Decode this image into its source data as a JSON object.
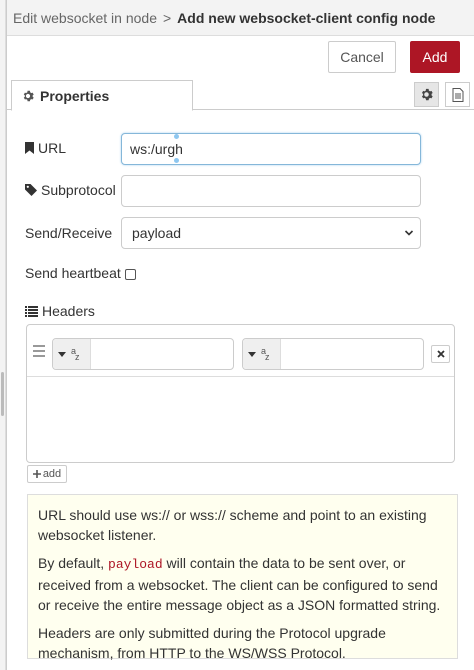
{
  "breadcrumb": {
    "previous": "Edit websocket in node",
    "separator": ">",
    "current": "Add new websocket-client config node"
  },
  "toolbar": {
    "cancel_label": "Cancel",
    "add_label": "Add"
  },
  "tabs": {
    "properties_label": "Properties",
    "icons": [
      "gear-icon",
      "description-icon"
    ]
  },
  "form": {
    "url": {
      "label": "URL",
      "value": "ws:/urgh"
    },
    "subprotocol": {
      "label": "Subprotocol",
      "value": ""
    },
    "send_receive": {
      "label": "Send/Receive",
      "selected": "payload"
    },
    "heartbeat": {
      "label": "Send heartbeat",
      "checked": false
    },
    "headers": {
      "label": "Headers"
    }
  },
  "headers_add_label": "add",
  "help": {
    "p1": "URL should use ws:// or wss:// scheme and point to an existing websocket listener.",
    "p2_before": "By default, ",
    "p2_code": "payload",
    "p2_after": " will contain the data to be sent over, or received from a websocket. The client can be configured to send or receive the entire message object as a JSON formatted string.",
    "p3": "Headers are only submitted during the Protocol upgrade mechanism, from HTTP to the WS/WSS Protocol."
  },
  "colors": {
    "accent_red": "#ad1625",
    "help_bg": "#ffffef",
    "header_bg": "#f3f3f3"
  }
}
